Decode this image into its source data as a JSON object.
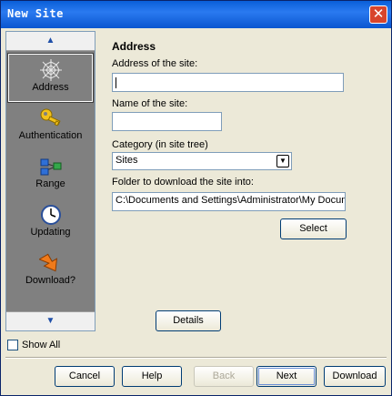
{
  "window": {
    "title": "New Site",
    "close_symbol": "✕"
  },
  "sidebar": {
    "items": [
      {
        "label": "Address",
        "icon": "spider-web-icon",
        "selected": true
      },
      {
        "label": "Authentication",
        "icon": "key-icon",
        "selected": false
      },
      {
        "label": "Range",
        "icon": "network-nodes-icon",
        "selected": false
      },
      {
        "label": "Updating",
        "icon": "clock-icon",
        "selected": false
      },
      {
        "label": "Download?",
        "icon": "arrow-download-icon",
        "selected": false
      }
    ],
    "scroll_up_symbol": "▲",
    "scroll_down_symbol": "▼"
  },
  "show_all": {
    "label": "Show All",
    "checked": false
  },
  "form": {
    "heading": "Address",
    "address_label": "Address of the site:",
    "address_value": "",
    "name_label": "Name of the site:",
    "name_value": "",
    "category_label": "Category (in site tree)",
    "category_value": "Sites",
    "folder_label": "Folder to download the site into:",
    "folder_value": "C:\\Documents and Settings\\Administrator\\My Docum",
    "select_button": "Select",
    "details_button": "Details"
  },
  "footer": {
    "cancel": "Cancel",
    "help": "Help",
    "back": "Back",
    "next": "Next",
    "download": "Download"
  },
  "colors": {
    "title_bar": "#0a5fd8",
    "sidebar_bg": "#808080",
    "dialog_bg": "#ece9d8"
  }
}
